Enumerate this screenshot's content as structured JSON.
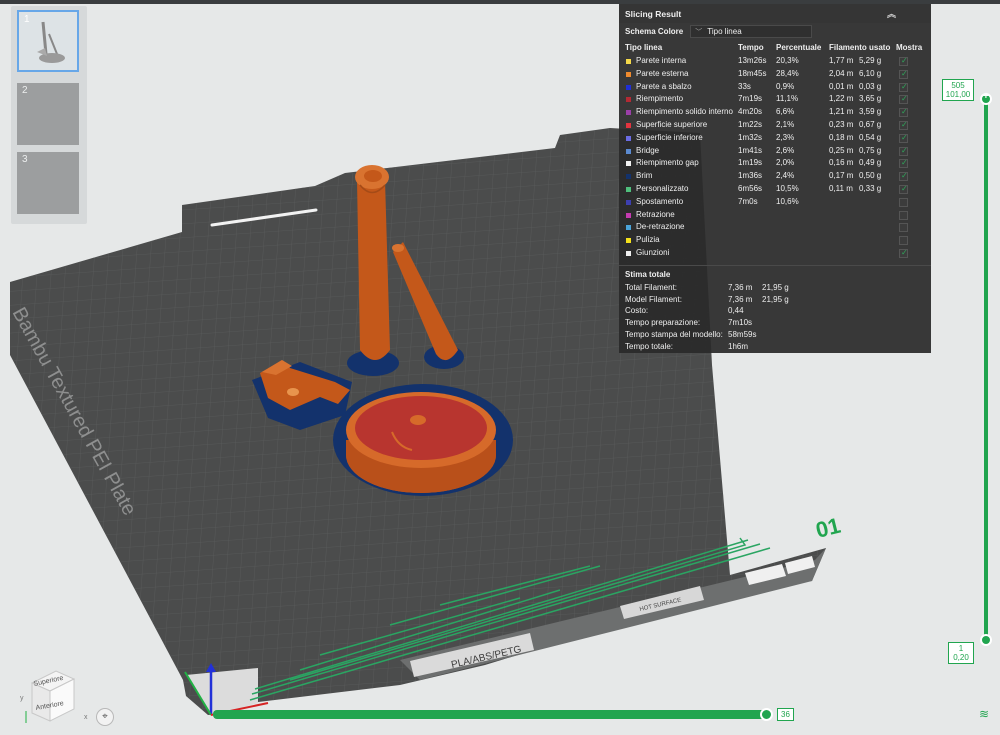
{
  "plate_list": [
    {
      "number": "1",
      "active": true
    },
    {
      "number": "2",
      "active": false
    },
    {
      "number": "3",
      "active": false
    }
  ],
  "bed": {
    "brand_text": "Bambu Textured PEI Plate",
    "material_text": "PLA/ABS/PETG",
    "hot_surface_text": "HOT SURFACE",
    "plate_number": "01"
  },
  "slicing_result": {
    "title": "Slicing Result",
    "collapse_icon": "double-chevron-up-icon",
    "scheme_label": "Schema Colore",
    "scheme_value": "Tipo linea",
    "headers": {
      "type": "Tipo linea",
      "time": "Tempo",
      "percent": "Percentuale",
      "filament": "Filamento usato",
      "show": "Mostra"
    },
    "rows": [
      {
        "name": "Parete interna",
        "color": "#f5d94a",
        "time": "13m26s",
        "percent": "20,3%",
        "length": "1,77 m",
        "weight": "5,29 g",
        "show": true
      },
      {
        "name": "Parete esterna",
        "color": "#ef8a2e",
        "time": "18m45s",
        "percent": "28,4%",
        "length": "2,04 m",
        "weight": "6,10 g",
        "show": true
      },
      {
        "name": "Parete a sbalzo",
        "color": "#1f2fd6",
        "time": "33s",
        "percent": "0,9%",
        "length": "0,01 m",
        "weight": "0,03 g",
        "show": true
      },
      {
        "name": "Riempimento",
        "color": "#b32a34",
        "time": "7m19s",
        "percent": "11,1%",
        "length": "1,22 m",
        "weight": "3,65 g",
        "show": true
      },
      {
        "name": "Riempimento solido interno",
        "color": "#9b3fa8",
        "time": "4m20s",
        "percent": "6,6%",
        "length": "1,21 m",
        "weight": "3,59 g",
        "show": true
      },
      {
        "name": "Superficie superiore",
        "color": "#e2343f",
        "time": "1m22s",
        "percent": "2,1%",
        "length": "0,23 m",
        "weight": "0,67 g",
        "show": true
      },
      {
        "name": "Superficie inferiore",
        "color": "#6b6ce4",
        "time": "1m32s",
        "percent": "2,3%",
        "length": "0,18 m",
        "weight": "0,54 g",
        "show": true
      },
      {
        "name": "Bridge",
        "color": "#5b8ad0",
        "time": "1m41s",
        "percent": "2,6%",
        "length": "0,25 m",
        "weight": "0,75 g",
        "show": true
      },
      {
        "name": "Riempimento gap",
        "color": "#f2f2f2",
        "time": "1m19s",
        "percent": "2,0%",
        "length": "0,16 m",
        "weight": "0,49 g",
        "show": true
      },
      {
        "name": "Brim",
        "color": "#13326c",
        "time": "1m36s",
        "percent": "2,4%",
        "length": "0,17 m",
        "weight": "0,50 g",
        "show": true
      },
      {
        "name": "Personalizzato",
        "color": "#4fbf7c",
        "time": "6m56s",
        "percent": "10,5%",
        "length": "0,11 m",
        "weight": "0,33 g",
        "show": true
      },
      {
        "name": "Spostamento",
        "color": "#3d3fb0",
        "time": "7m0s",
        "percent": "10,6%",
        "length": "",
        "weight": "",
        "show": false
      },
      {
        "name": "Retrazione",
        "color": "#c43bb0",
        "time": "",
        "percent": "",
        "length": "",
        "weight": "",
        "show": false
      },
      {
        "name": "De-retrazione",
        "color": "#4aa3d8",
        "time": "",
        "percent": "",
        "length": "",
        "weight": "",
        "show": false
      },
      {
        "name": "Pulizia",
        "color": "#f5e21c",
        "time": "",
        "percent": "",
        "length": "",
        "weight": "",
        "show": false
      },
      {
        "name": "Giunzioni",
        "color": "#f0f0f0",
        "time": "",
        "percent": "",
        "length": "",
        "weight": "",
        "show": true
      }
    ],
    "estimate_title": "Stima totale",
    "estimates": [
      {
        "label": "Total Filament:",
        "length": "7,36 m",
        "weight": "21,95 g"
      },
      {
        "label": "Model Filament:",
        "length": "7,36 m",
        "weight": "21,95 g"
      },
      {
        "label": "Costo:",
        "length": "0,44",
        "weight": ""
      },
      {
        "label": "Tempo preparazione:",
        "length": "7m10s",
        "weight": ""
      },
      {
        "label": "Tempo stampa del modello:",
        "length": "58m59s",
        "weight": ""
      },
      {
        "label": "Tempo totale:",
        "length": "1h6m",
        "weight": ""
      }
    ]
  },
  "layer_slider": {
    "top_layer": "505",
    "top_height": "101,00",
    "bottom_layer": "1",
    "bottom_height": "0,20",
    "top_fraction": 1.0,
    "accent_color": "#21a54f"
  },
  "move_slider": {
    "value": "36",
    "fraction": 1.0
  },
  "view_cube": {
    "top_label": "Superiore",
    "front_label": "Anteriore",
    "axis_x": "x",
    "axis_y": "y"
  },
  "icons": {
    "fit_view": "fit-view-icon",
    "layers": "layers-icon"
  }
}
